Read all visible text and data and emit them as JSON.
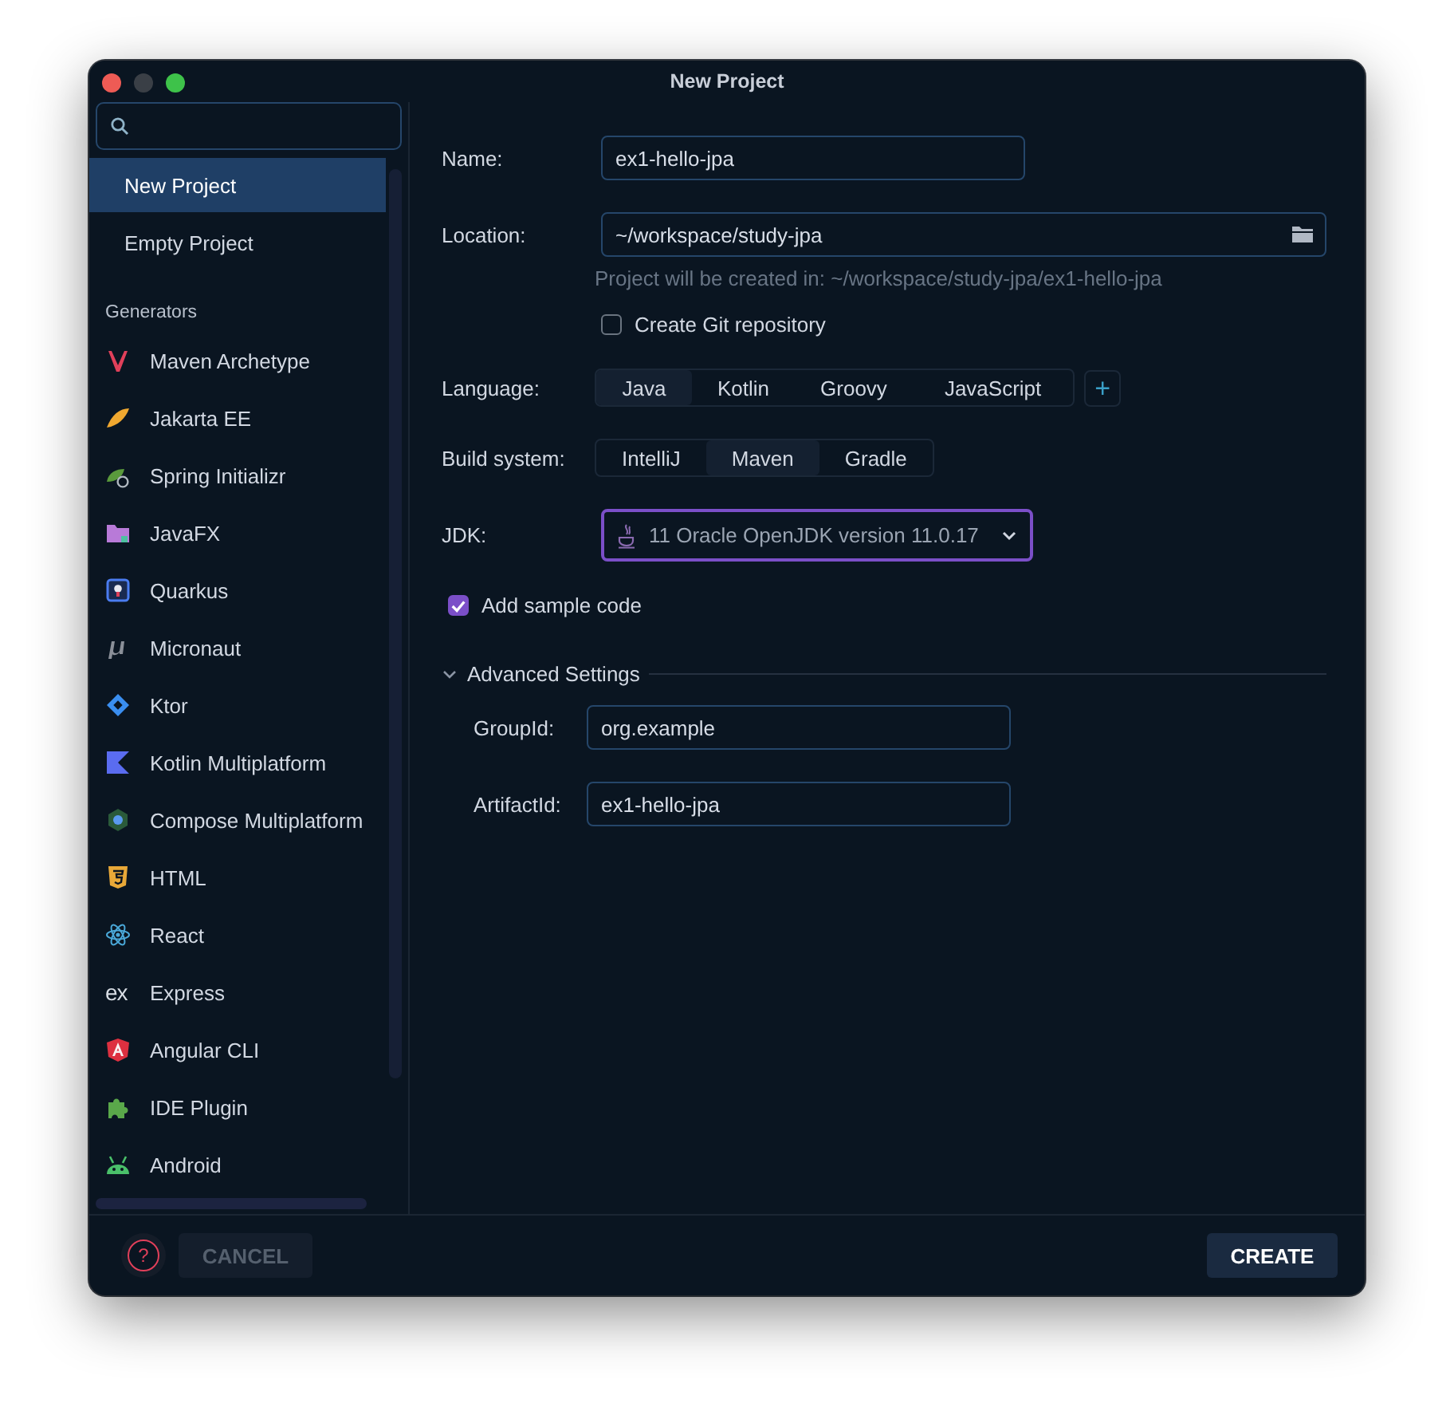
{
  "window": {
    "title": "New Project"
  },
  "sidebar": {
    "items": [
      {
        "label": "New Project",
        "selected": true
      },
      {
        "label": "Empty Project",
        "selected": false
      }
    ],
    "section": "Generators",
    "generators": [
      {
        "label": "Maven Archetype",
        "kind": "maven",
        "selected": false
      },
      {
        "label": "Jakarta EE",
        "kind": "jakarta",
        "selected": false
      },
      {
        "label": "Spring Initializr",
        "kind": "spring",
        "selected": false
      },
      {
        "label": "JavaFX",
        "kind": "javafx",
        "selected": false
      },
      {
        "label": "Quarkus",
        "kind": "quarkus",
        "selected": false
      },
      {
        "label": "Micronaut",
        "kind": "micronaut",
        "selected": false
      },
      {
        "label": "Ktor",
        "kind": "ktor",
        "selected": false
      },
      {
        "label": "Kotlin Multiplatform",
        "kind": "kotlin",
        "selected": false
      },
      {
        "label": "Compose Multiplatform",
        "kind": "compose",
        "selected": false
      },
      {
        "label": "HTML",
        "kind": "html",
        "selected": false
      },
      {
        "label": "React",
        "kind": "react",
        "selected": false
      },
      {
        "label": "Express",
        "kind": "text",
        "icon_text": "ex",
        "selected": false
      },
      {
        "label": "Angular CLI",
        "kind": "angular",
        "selected": false
      },
      {
        "label": "IDE Plugin",
        "kind": "plugin",
        "selected": false
      },
      {
        "label": "Android",
        "kind": "android",
        "selected": false
      }
    ]
  },
  "form": {
    "name": {
      "label": "Name:",
      "value": "ex1-hello-jpa"
    },
    "location": {
      "label": "Location:",
      "value": "~/workspace/study-jpa",
      "hint": "Project will be created in: ~/workspace/study-jpa/ex1-hello-jpa"
    },
    "git": {
      "label": "Create Git repository",
      "checked": false
    },
    "language": {
      "label": "Language:",
      "options": [
        {
          "label": "Java",
          "selected": true
        },
        {
          "label": "Kotlin",
          "selected": false
        },
        {
          "label": "Groovy",
          "selected": false
        },
        {
          "label": "JavaScript",
          "selected": false
        }
      ],
      "add": "+"
    },
    "build_system": {
      "label": "Build system:",
      "options": [
        {
          "label": "IntelliJ",
          "selected": false
        },
        {
          "label": "Maven",
          "selected": true
        },
        {
          "label": "Gradle",
          "selected": false
        }
      ]
    },
    "jdk": {
      "label": "JDK:",
      "value": "11 Oracle OpenJDK version 11.0.17"
    },
    "sample_code": {
      "label": "Add sample code",
      "checked": true
    },
    "advanced": {
      "label": "Advanced Settings",
      "expanded": true,
      "fields": [
        {
          "label": "GroupId:",
          "value": "org.example"
        },
        {
          "label": "ArtifactId:",
          "value": "ex1-hello-jpa"
        }
      ]
    }
  },
  "footer": {
    "help": "?",
    "cancel": {
      "label": "CANCEL",
      "disabled": true
    },
    "create": {
      "label": "CREATE",
      "disabled": false
    }
  }
}
